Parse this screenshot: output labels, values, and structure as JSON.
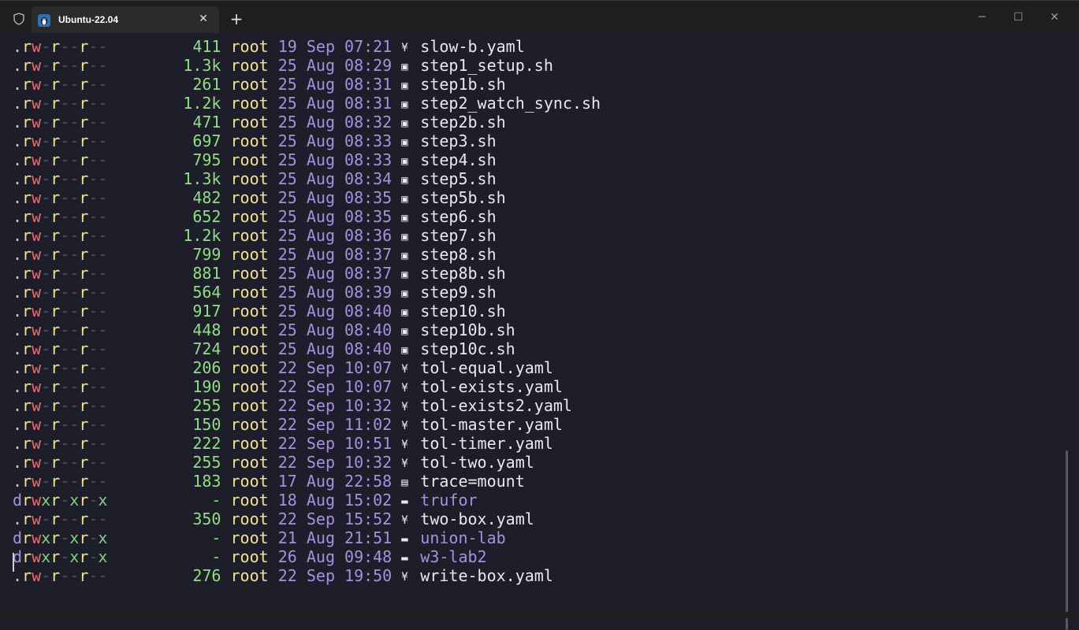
{
  "window": {
    "tab_title": "Ubuntu-22.04",
    "tab_close": "✕",
    "new_tab": "+",
    "minimize": "─",
    "maximize": "☐",
    "close": "✕"
  },
  "colors": {
    "background": "#1e1e2a",
    "perm_read": "#f2e488",
    "perm_write": "#f06c6c",
    "perm_exec": "#78d670",
    "size": "#8de07f",
    "date": "#a98fe0",
    "directory": "#a98fe0"
  },
  "listing": [
    {
      "type": ".",
      "perms": "rw-r--r--",
      "size": "411",
      "user": "root",
      "date": "19 Sep 07:21",
      "icon": "yaml-icon",
      "name": "slow-b.yaml"
    },
    {
      "type": ".",
      "perms": "rw-r--r--",
      "size": "1.3k",
      "user": "root",
      "date": "25 Aug 08:29",
      "icon": "shell-icon",
      "name": "step1_setup.sh"
    },
    {
      "type": ".",
      "perms": "rw-r--r--",
      "size": "261",
      "user": "root",
      "date": "25 Aug 08:31",
      "icon": "shell-icon",
      "name": "step1b.sh"
    },
    {
      "type": ".",
      "perms": "rw-r--r--",
      "size": "1.2k",
      "user": "root",
      "date": "25 Aug 08:31",
      "icon": "shell-icon",
      "name": "step2_watch_sync.sh"
    },
    {
      "type": ".",
      "perms": "rw-r--r--",
      "size": "471",
      "user": "root",
      "date": "25 Aug 08:32",
      "icon": "shell-icon",
      "name": "step2b.sh"
    },
    {
      "type": ".",
      "perms": "rw-r--r--",
      "size": "697",
      "user": "root",
      "date": "25 Aug 08:33",
      "icon": "shell-icon",
      "name": "step3.sh"
    },
    {
      "type": ".",
      "perms": "rw-r--r--",
      "size": "795",
      "user": "root",
      "date": "25 Aug 08:33",
      "icon": "shell-icon",
      "name": "step4.sh"
    },
    {
      "type": ".",
      "perms": "rw-r--r--",
      "size": "1.3k",
      "user": "root",
      "date": "25 Aug 08:34",
      "icon": "shell-icon",
      "name": "step5.sh"
    },
    {
      "type": ".",
      "perms": "rw-r--r--",
      "size": "482",
      "user": "root",
      "date": "25 Aug 08:35",
      "icon": "shell-icon",
      "name": "step5b.sh"
    },
    {
      "type": ".",
      "perms": "rw-r--r--",
      "size": "652",
      "user": "root",
      "date": "25 Aug 08:35",
      "icon": "shell-icon",
      "name": "step6.sh"
    },
    {
      "type": ".",
      "perms": "rw-r--r--",
      "size": "1.2k",
      "user": "root",
      "date": "25 Aug 08:36",
      "icon": "shell-icon",
      "name": "step7.sh"
    },
    {
      "type": ".",
      "perms": "rw-r--r--",
      "size": "799",
      "user": "root",
      "date": "25 Aug 08:37",
      "icon": "shell-icon",
      "name": "step8.sh"
    },
    {
      "type": ".",
      "perms": "rw-r--r--",
      "size": "881",
      "user": "root",
      "date": "25 Aug 08:37",
      "icon": "shell-icon",
      "name": "step8b.sh"
    },
    {
      "type": ".",
      "perms": "rw-r--r--",
      "size": "564",
      "user": "root",
      "date": "25 Aug 08:39",
      "icon": "shell-icon",
      "name": "step9.sh"
    },
    {
      "type": ".",
      "perms": "rw-r--r--",
      "size": "917",
      "user": "root",
      "date": "25 Aug 08:40",
      "icon": "shell-icon",
      "name": "step10.sh"
    },
    {
      "type": ".",
      "perms": "rw-r--r--",
      "size": "448",
      "user": "root",
      "date": "25 Aug 08:40",
      "icon": "shell-icon",
      "name": "step10b.sh"
    },
    {
      "type": ".",
      "perms": "rw-r--r--",
      "size": "724",
      "user": "root",
      "date": "25 Aug 08:40",
      "icon": "shell-icon",
      "name": "step10c.sh"
    },
    {
      "type": ".",
      "perms": "rw-r--r--",
      "size": "206",
      "user": "root",
      "date": "22 Sep 10:07",
      "icon": "yaml-icon",
      "name": "tol-equal.yaml"
    },
    {
      "type": ".",
      "perms": "rw-r--r--",
      "size": "190",
      "user": "root",
      "date": "22 Sep 10:07",
      "icon": "yaml-icon",
      "name": "tol-exists.yaml"
    },
    {
      "type": ".",
      "perms": "rw-r--r--",
      "size": "255",
      "user": "root",
      "date": "22 Sep 10:32",
      "icon": "yaml-icon",
      "name": "tol-exists2.yaml"
    },
    {
      "type": ".",
      "perms": "rw-r--r--",
      "size": "150",
      "user": "root",
      "date": "22 Sep 11:02",
      "icon": "yaml-icon",
      "name": "tol-master.yaml"
    },
    {
      "type": ".",
      "perms": "rw-r--r--",
      "size": "222",
      "user": "root",
      "date": "22 Sep 10:51",
      "icon": "yaml-icon",
      "name": "tol-timer.yaml"
    },
    {
      "type": ".",
      "perms": "rw-r--r--",
      "size": "255",
      "user": "root",
      "date": "22 Sep 10:32",
      "icon": "yaml-icon",
      "name": "tol-two.yaml"
    },
    {
      "type": ".",
      "perms": "rw-r--r--",
      "size": "183",
      "user": "root",
      "date": "17 Aug 22:58",
      "icon": "file-icon",
      "name": "trace=mount"
    },
    {
      "type": "d",
      "perms": "rwxr-xr-x",
      "size": "-",
      "user": "root",
      "date": "18 Aug 15:02",
      "icon": "folder-icon",
      "name": "trufor"
    },
    {
      "type": ".",
      "perms": "rw-r--r--",
      "size": "350",
      "user": "root",
      "date": "22 Sep 15:52",
      "icon": "yaml-icon",
      "name": "two-box.yaml"
    },
    {
      "type": "d",
      "perms": "rwxr-xr-x",
      "size": "-",
      "user": "root",
      "date": "21 Aug 21:51",
      "icon": "folder-icon",
      "name": "union-lab"
    },
    {
      "type": "d",
      "perms": "rwxr-xr-x",
      "size": "-",
      "user": "root",
      "date": "26 Aug 09:48",
      "icon": "folder-icon",
      "name": "w3-lab2"
    },
    {
      "type": ".",
      "perms": "rw-r--r--",
      "size": "276",
      "user": "root",
      "date": "22 Sep 19:50",
      "icon": "yaml-icon",
      "name": "write-box.yaml"
    }
  ]
}
